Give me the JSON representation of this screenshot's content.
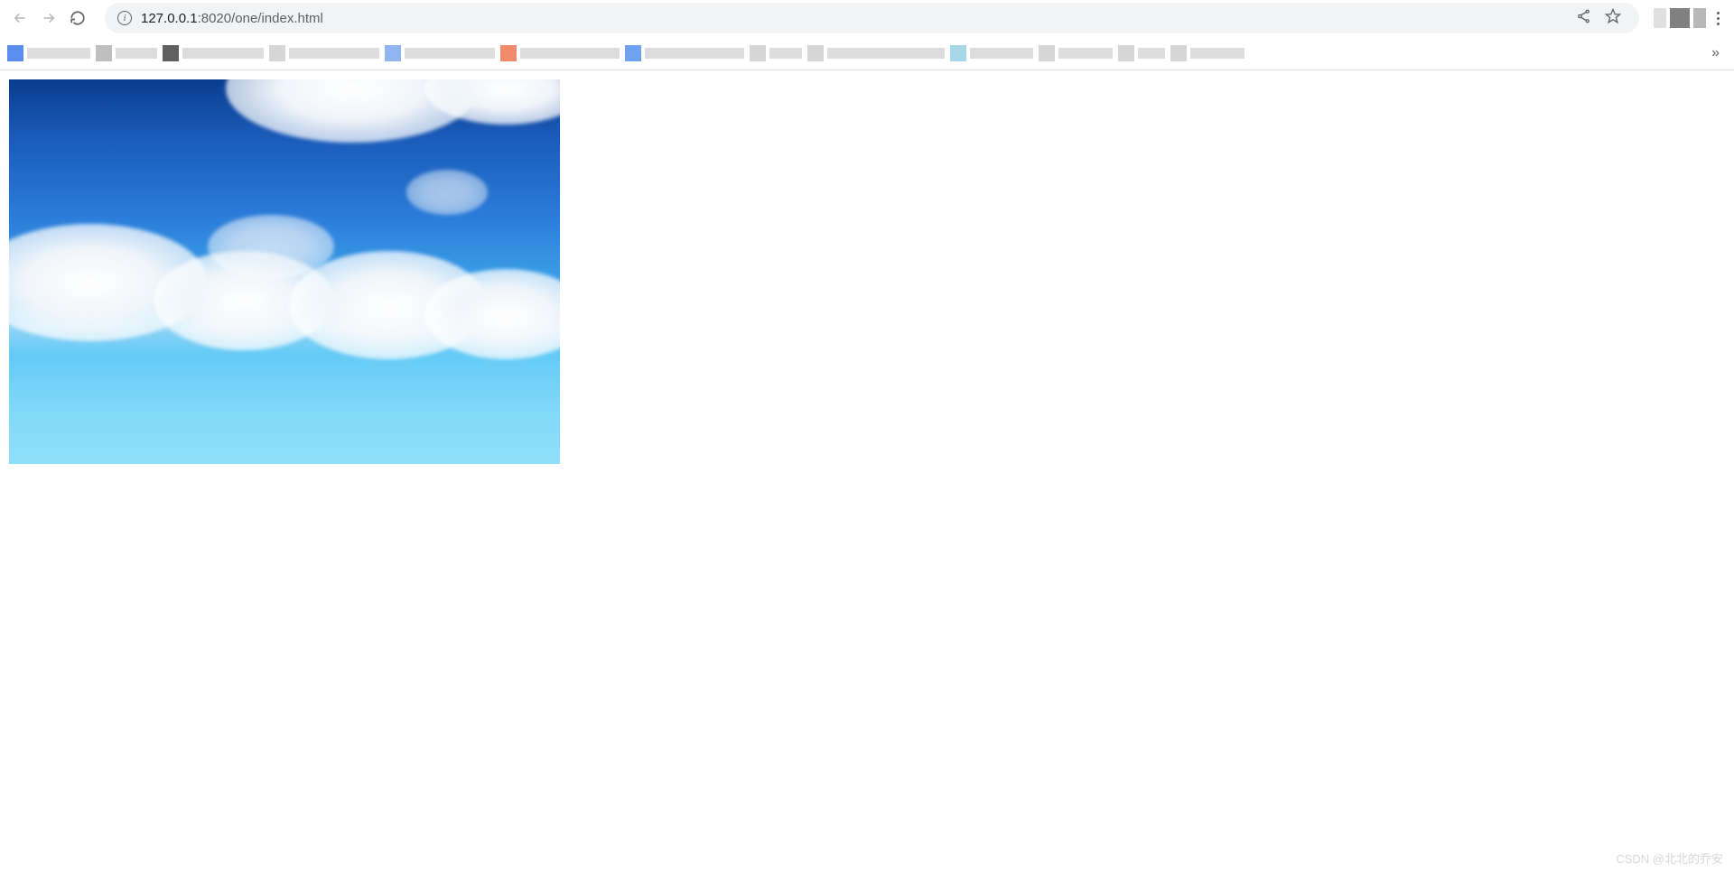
{
  "browser": {
    "url_host": "127.0.0.1",
    "url_rest": ":8020/one/index.html",
    "overflow_label": "»",
    "info_glyph": "i"
  },
  "bookmarks": [
    {
      "favicon_color": "#5b8def",
      "label_width": 70
    },
    {
      "favicon_color": "#bfbfbf",
      "label_width": 46
    },
    {
      "favicon_color": "#606060",
      "label_width": 90
    },
    {
      "favicon_color": "#d6d6d6",
      "label_width": 100
    },
    {
      "favicon_color": "#8fb5f0",
      "label_width": 100
    },
    {
      "favicon_color": "#f28b6b",
      "label_width": 110
    },
    {
      "favicon_color": "#6ea1f0",
      "label_width": 110
    },
    {
      "favicon_color": "#d6d6d6",
      "label_width": 36
    },
    {
      "favicon_color": "#d6d6d6",
      "label_width": 130
    },
    {
      "favicon_color": "#a7d8ea",
      "label_width": 70
    },
    {
      "favicon_color": "#d6d6d6",
      "label_width": 60
    },
    {
      "favicon_color": "#d6d6d6",
      "label_width": 30
    },
    {
      "favicon_color": "#d6d6d6",
      "label_width": 60
    }
  ],
  "content": {
    "image_alt": "sky-clouds"
  },
  "watermark": "CSDN @北北的乔安"
}
